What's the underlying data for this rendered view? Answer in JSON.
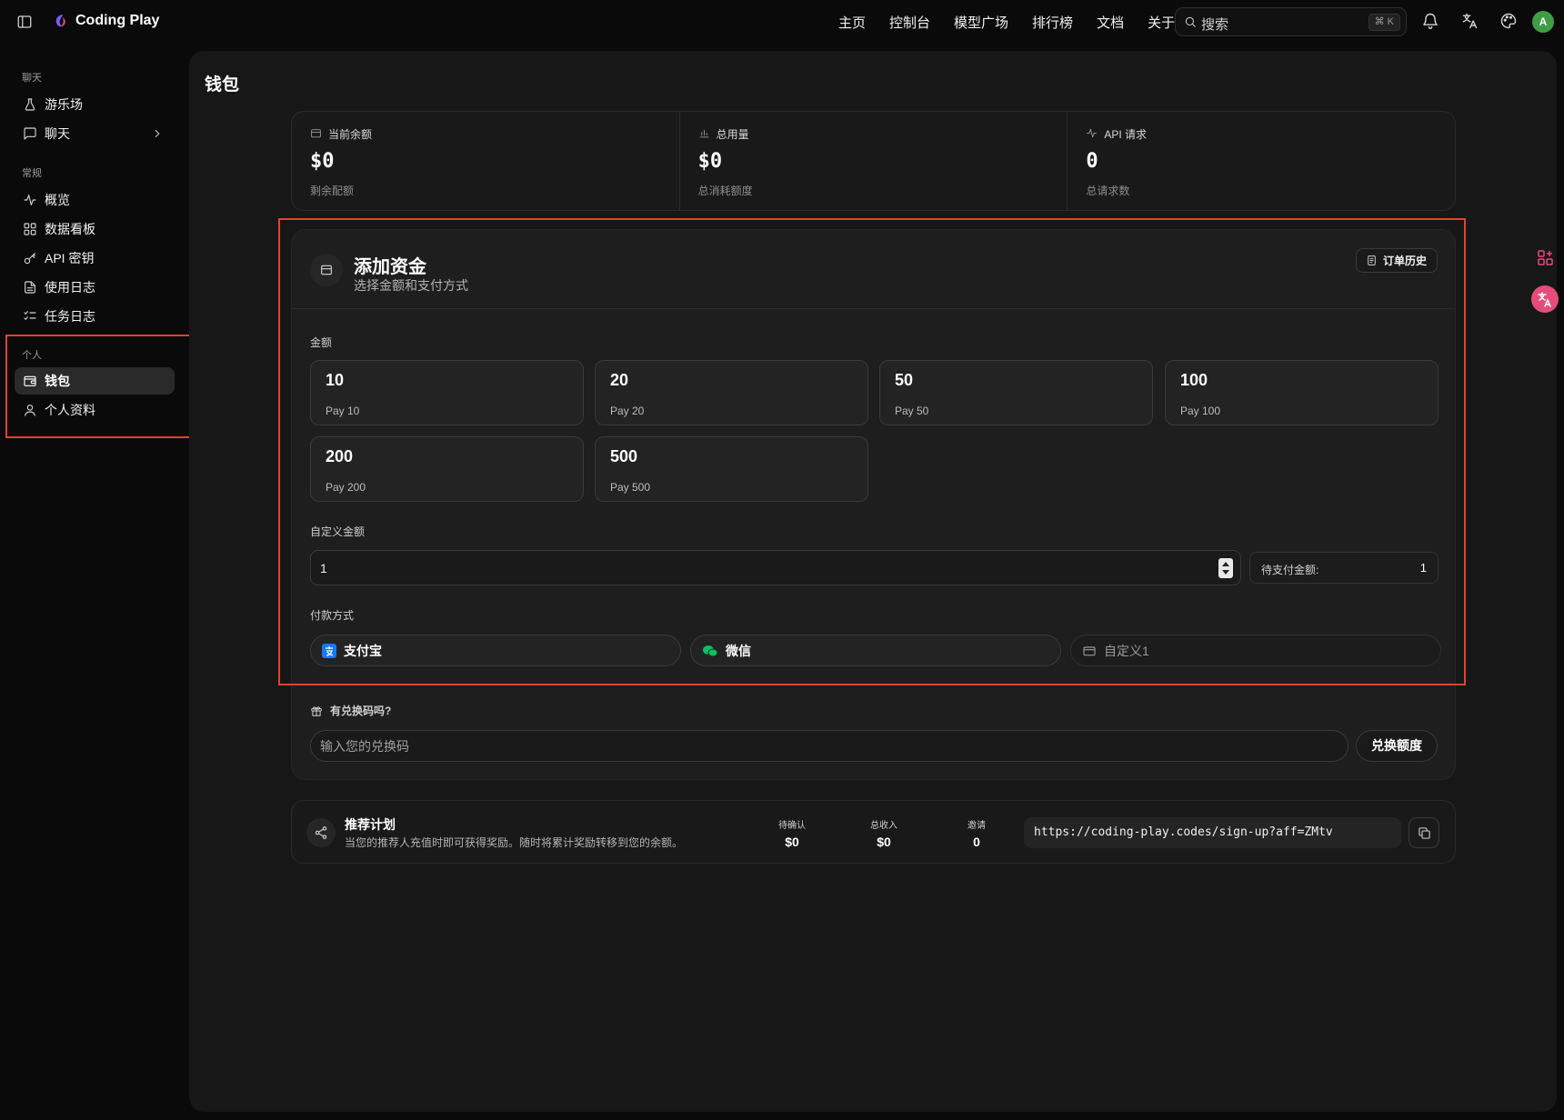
{
  "app": {
    "title": "Coding Play"
  },
  "nav": [
    "主页",
    "控制台",
    "模型广场",
    "排行榜",
    "文档",
    "关于"
  ],
  "search": {
    "placeholder": "搜索",
    "shortcut": "⌘ K"
  },
  "user": {
    "initial": "A",
    "avatar_color": "#3f9d45"
  },
  "sidebar": {
    "sections": [
      {
        "label": "聊天",
        "items": [
          "游乐场",
          "聊天"
        ]
      },
      {
        "label": "常规",
        "items": [
          "概览",
          "数据看板",
          "API 密钥",
          "使用日志",
          "任务日志"
        ]
      },
      {
        "label": "个人",
        "items": [
          "钱包",
          "个人资料"
        ]
      }
    ],
    "active": "钱包"
  },
  "page": {
    "title": "钱包"
  },
  "stats": [
    {
      "label": "当前余额",
      "value": "$0",
      "sub": "剩余配额"
    },
    {
      "label": "总用量",
      "value": "$0",
      "sub": "总消耗额度"
    },
    {
      "label": "API 请求",
      "value": "0",
      "sub": "总请求数"
    }
  ],
  "add_funds": {
    "title": "添加资金",
    "subtitle": "选择金额和支付方式",
    "order_history": "订单历史",
    "amount_label": "金额",
    "amounts": [
      {
        "value": "10",
        "pay": "Pay 10"
      },
      {
        "value": "20",
        "pay": "Pay 20"
      },
      {
        "value": "50",
        "pay": "Pay 50"
      },
      {
        "value": "100",
        "pay": "Pay 100"
      },
      {
        "value": "200",
        "pay": "Pay 200"
      },
      {
        "value": "500",
        "pay": "Pay 500"
      }
    ],
    "custom_label": "自定义金额",
    "custom_value": "1",
    "pending_label": "待支付金额:",
    "pending_value": "1",
    "payment_label": "付款方式",
    "payments": [
      "支付宝",
      "微信",
      "自定义1"
    ],
    "redeem_label": "有兑换码吗?",
    "redeem_placeholder": "输入您的兑换码",
    "redeem_button": "兑换额度"
  },
  "referral": {
    "title": "推荐计划",
    "subtitle": "当您的推荐人充值时即可获得奖励。随时将累计奖励转移到您的余额。",
    "stats": [
      {
        "label": "待确认",
        "value": "$0"
      },
      {
        "label": "总收入",
        "value": "$0"
      },
      {
        "label": "邀请",
        "value": "0"
      }
    ],
    "link": "https://coding-play.codes/sign-up?aff=ZMtv"
  },
  "colors": {
    "highlight": "#e0432f",
    "alipay": "#1677ff",
    "wechat": "#07c160"
  }
}
